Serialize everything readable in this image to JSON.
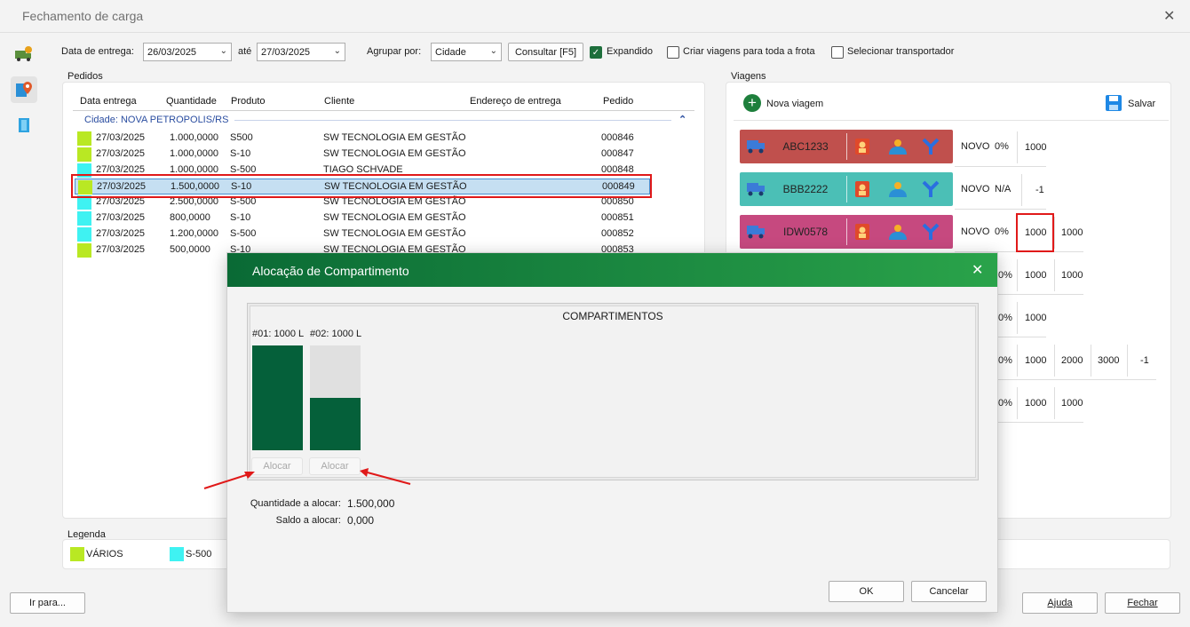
{
  "window": {
    "title": "Fechamento de carga",
    "close": "✕"
  },
  "toolbar": {
    "date_label": "Data de entrega:",
    "date_from": "26/03/2025",
    "until_label": "até",
    "date_to": "27/03/2025",
    "group_label": "Agrupar por:",
    "group_value": "Cidade",
    "consult_button": "Consultar [F5]",
    "expanded_label": "Expandido",
    "expanded_checked": true,
    "fleet_label": "Criar viagens para toda a frota",
    "fleet_checked": false,
    "carrier_label": "Selecionar transportador",
    "carrier_checked": false
  },
  "pedidos": {
    "title": "Pedidos",
    "columns": [
      "Data entrega",
      "Quantidade",
      "Produto",
      "Cliente",
      "Endereço de entrega",
      "Pedido"
    ],
    "group": "Cidade: NOVA PETROPOLIS/RS",
    "rows": [
      {
        "color": "#b9e823",
        "date": "27/03/2025",
        "qty": "1.000,0000",
        "product": "S500",
        "client": "SW TECNOLOGIA EM GESTÃO",
        "order": "000846"
      },
      {
        "color": "#b9e823",
        "date": "27/03/2025",
        "qty": "1.000,0000",
        "product": "S-10",
        "client": "SW TECNOLOGIA EM GESTÃO",
        "order": "000847"
      },
      {
        "color": "#3ff2f2",
        "date": "27/03/2025",
        "qty": "1.000,0000",
        "product": "S-500",
        "client": "TIAGO SCHVADE",
        "order": "000848"
      },
      {
        "color": "#b9e823",
        "date": "27/03/2025",
        "qty": "1.500,0000",
        "product": "S-10",
        "client": "SW TECNOLOGIA EM GESTÃO",
        "order": "000849"
      },
      {
        "color": "#3ff2f2",
        "date": "27/03/2025",
        "qty": "2.500,0000",
        "product": "S-500",
        "client": "SW TECNOLOGIA EM GESTÃO",
        "order": "000850"
      },
      {
        "color": "#3ff2f2",
        "date": "27/03/2025",
        "qty": "800,0000",
        "product": "S-10",
        "client": "SW TECNOLOGIA EM GESTÃO",
        "order": "000851"
      },
      {
        "color": "#3ff2f2",
        "date": "27/03/2025",
        "qty": "1.200,0000",
        "product": "S-500",
        "client": "SW TECNOLOGIA EM GESTÃO",
        "order": "000852"
      },
      {
        "color": "#b9e823",
        "date": "27/03/2025",
        "qty": "500,0000",
        "product": "S-10",
        "client": "SW TECNOLOGIA EM GESTÃO",
        "order": "000853"
      }
    ]
  },
  "legend": {
    "title": "Legenda",
    "items": [
      {
        "label": "VÁRIOS",
        "color": "#b9e823"
      },
      {
        "label": "S-500",
        "color": "#3ff2f2"
      }
    ]
  },
  "viagens": {
    "title": "Viagens",
    "new_button": "Nova viagem",
    "save_button": "Salvar",
    "trips": [
      {
        "plate": "ABC1233",
        "color": "#c0504d",
        "status": "NOVO",
        "pct": "0%",
        "caps": [
          "1000"
        ]
      },
      {
        "plate": "BBB2222",
        "color": "#4bbfb6",
        "status": "NOVO",
        "pct": "N/A",
        "caps": [
          "-1"
        ]
      },
      {
        "plate": "IDW0578",
        "color": "#c6497f",
        "status": "NOVO",
        "pct": "0%",
        "caps": [
          "1000",
          "1000"
        ]
      }
    ],
    "hidden_rows": [
      {
        "pct": "0%",
        "caps": [
          "1000",
          "1000"
        ]
      },
      {
        "pct": "0%",
        "caps": [
          "1000"
        ]
      },
      {
        "pct": "0%",
        "caps": [
          "1000",
          "2000",
          "3000",
          "-1"
        ]
      },
      {
        "pct": "0%",
        "caps": [
          "1000",
          "1000"
        ]
      }
    ]
  },
  "footer": {
    "goto_button": "Ir para...",
    "help_button": "Ajuda",
    "close_button": "Fechar"
  },
  "modal": {
    "title": "Alocação de Compartimento",
    "close": "✕",
    "section": "COMPARTIMENTOS",
    "compartments": [
      {
        "label": "#01: 1000 L",
        "fill_fraction": 1.0,
        "button": "Alocar"
      },
      {
        "label": "#02: 1000 L",
        "fill_fraction": 0.5,
        "button": "Alocar"
      }
    ],
    "qty_label": "Quantidade a alocar:",
    "qty_value": "1.500,000",
    "balance_label": "Saldo a alocar:",
    "balance_value": "0,000",
    "ok_button": "OK",
    "cancel_button": "Cancelar"
  }
}
